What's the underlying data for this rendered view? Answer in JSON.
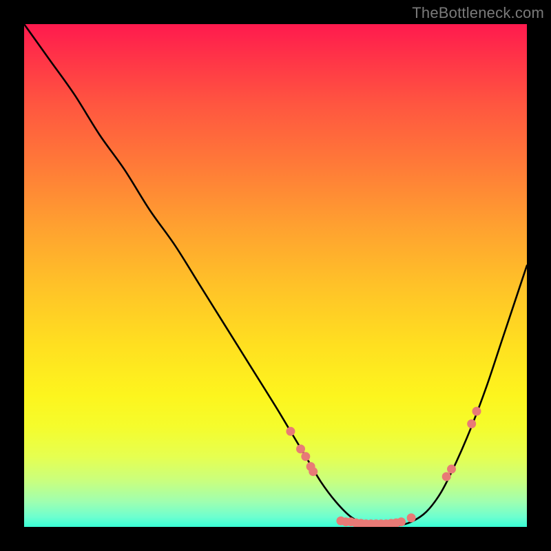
{
  "watermark": "TheBottleneck.com",
  "colors": {
    "background": "#000000",
    "curve": "#000000",
    "dots": "#e87a76",
    "gradient_top": "#ff1a4e",
    "gradient_bottom": "#38ffd6"
  },
  "chart_data": {
    "type": "line",
    "title": "",
    "xlabel": "",
    "ylabel": "",
    "xlim": [
      0,
      100
    ],
    "ylim": [
      0,
      100
    ],
    "curve": {
      "x": [
        0,
        5,
        10,
        15,
        20,
        25,
        30,
        35,
        40,
        45,
        50,
        53,
        56,
        59,
        62,
        65,
        68,
        71,
        74,
        77,
        80,
        83,
        86,
        89,
        92,
        95,
        100
      ],
      "y": [
        100,
        93,
        86,
        78,
        71,
        63,
        56,
        48,
        40,
        32,
        24,
        19,
        14,
        9,
        5,
        2,
        0.5,
        0,
        0.2,
        1,
        3,
        7,
        13,
        20,
        28,
        37,
        52
      ]
    },
    "markers": [
      {
        "x": 53,
        "y": 19
      },
      {
        "x": 55,
        "y": 15.5
      },
      {
        "x": 56,
        "y": 14
      },
      {
        "x": 57,
        "y": 12
      },
      {
        "x": 57.5,
        "y": 11
      },
      {
        "x": 63,
        "y": 1.2
      },
      {
        "x": 64,
        "y": 1.0
      },
      {
        "x": 65,
        "y": 1.0
      },
      {
        "x": 66,
        "y": 0.8
      },
      {
        "x": 67,
        "y": 0.7
      },
      {
        "x": 68,
        "y": 0.6
      },
      {
        "x": 69,
        "y": 0.6
      },
      {
        "x": 70,
        "y": 0.6
      },
      {
        "x": 71,
        "y": 0.6
      },
      {
        "x": 72,
        "y": 0.6
      },
      {
        "x": 73,
        "y": 0.7
      },
      {
        "x": 74,
        "y": 0.8
      },
      {
        "x": 75,
        "y": 1.0
      },
      {
        "x": 77,
        "y": 1.8
      },
      {
        "x": 84,
        "y": 10
      },
      {
        "x": 85,
        "y": 11.5
      },
      {
        "x": 89,
        "y": 20.5
      },
      {
        "x": 90,
        "y": 23
      }
    ]
  }
}
